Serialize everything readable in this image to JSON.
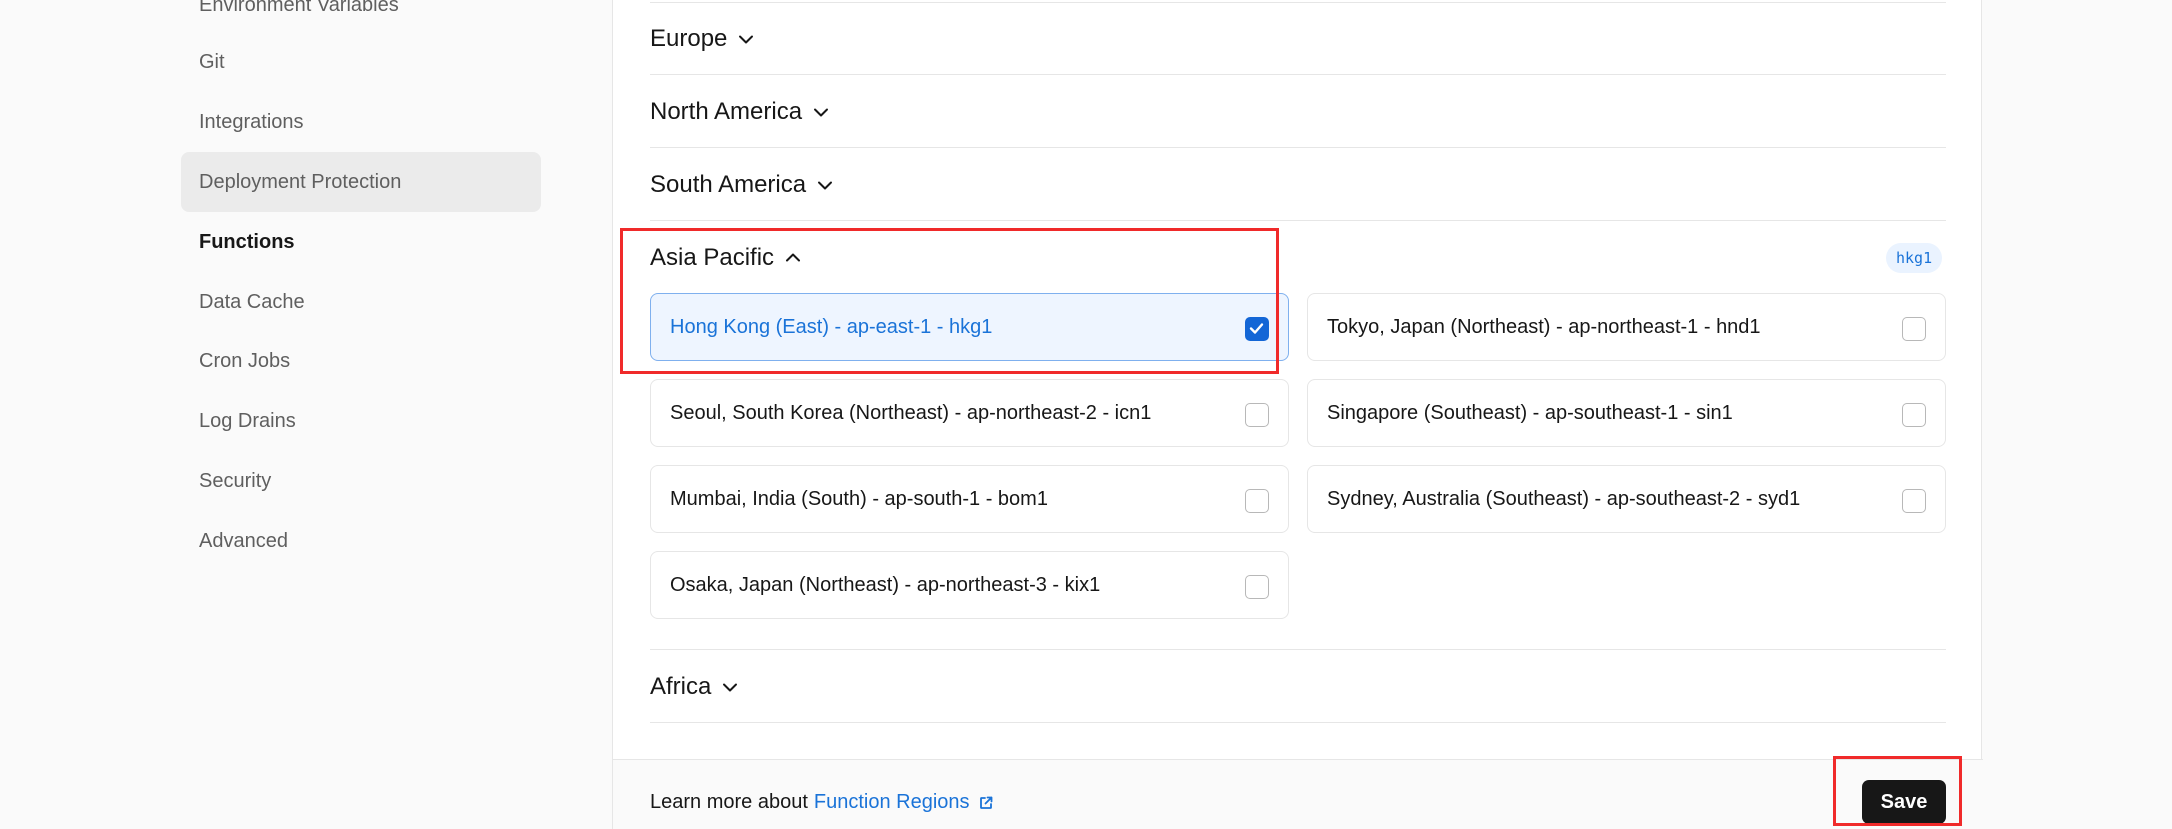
{
  "sidebar": {
    "items": [
      {
        "label": "Environment Variables"
      },
      {
        "label": "Git"
      },
      {
        "label": "Integrations"
      },
      {
        "label": "Deployment Protection"
      },
      {
        "label": "Functions"
      },
      {
        "label": "Data Cache"
      },
      {
        "label": "Cron Jobs"
      },
      {
        "label": "Log Drains"
      },
      {
        "label": "Security"
      },
      {
        "label": "Advanced"
      }
    ],
    "selected": "Deployment Protection",
    "active": "Functions"
  },
  "regions": {
    "groups": [
      {
        "label": "Europe",
        "expanded": false
      },
      {
        "label": "North America",
        "expanded": false
      },
      {
        "label": "South America",
        "expanded": false
      },
      {
        "label": "Asia Pacific",
        "expanded": true,
        "badge": "hkg1"
      },
      {
        "label": "Africa",
        "expanded": false
      }
    ],
    "asia_pacific": [
      {
        "label": "Hong Kong (East) - ap-east-1 - hkg1",
        "checked": true
      },
      {
        "label": "Tokyo, Japan (Northeast) - ap-northeast-1 - hnd1",
        "checked": false
      },
      {
        "label": "Seoul, South Korea (Northeast) - ap-northeast-2 - icn1",
        "checked": false
      },
      {
        "label": "Singapore (Southeast) - ap-southeast-1 - sin1",
        "checked": false
      },
      {
        "label": "Mumbai, India (South) - ap-south-1 - bom1",
        "checked": false
      },
      {
        "label": "Sydney, Australia (Southeast) - ap-southeast-2 - syd1",
        "checked": false
      },
      {
        "label": "Osaka, Japan (Northeast) - ap-northeast-3 - kix1",
        "checked": false
      }
    ]
  },
  "footer": {
    "prefix": "Learn more about",
    "link_label": "Function Regions",
    "save_label": "Save"
  },
  "colors": {
    "accent": "#1a73d8",
    "checkbox_on": "#1366d6",
    "highlight": "#f02a2a",
    "save_bg": "#171717"
  }
}
